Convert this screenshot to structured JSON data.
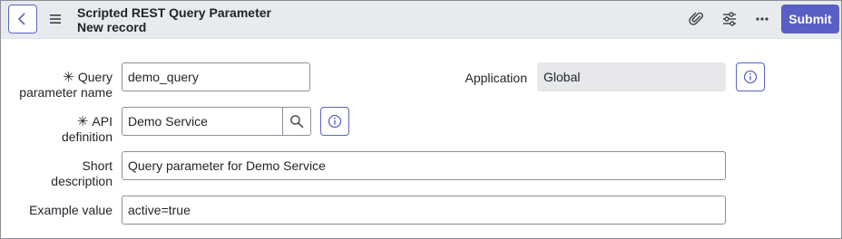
{
  "header": {
    "title": "Scripted REST Query Parameter",
    "subtitle": "New record",
    "submit_label": "Submit",
    "icons": [
      "chevron-left-icon",
      "hamburger-menu-icon",
      "paperclip-icon",
      "sliders-icon",
      "more-icon"
    ]
  },
  "form": {
    "required_marker": "✳",
    "query_parameter_name": {
      "label_line1": "Query",
      "label_line2": "parameter name",
      "value": "demo_query"
    },
    "application": {
      "label": "Application",
      "value": "Global"
    },
    "api_definition": {
      "label_line1": "API",
      "label_line2": "definition",
      "value": "Demo Service"
    },
    "short_description": {
      "label_line1": "Short",
      "label_line2": "description",
      "value": "Query parameter for Demo Service"
    },
    "example_value": {
      "label": "Example value",
      "value": "active=true"
    }
  },
  "colors": {
    "accent": "#5a5fc6",
    "header_bg": "#e8ebee",
    "readonly_bg": "#e6e8eb"
  }
}
